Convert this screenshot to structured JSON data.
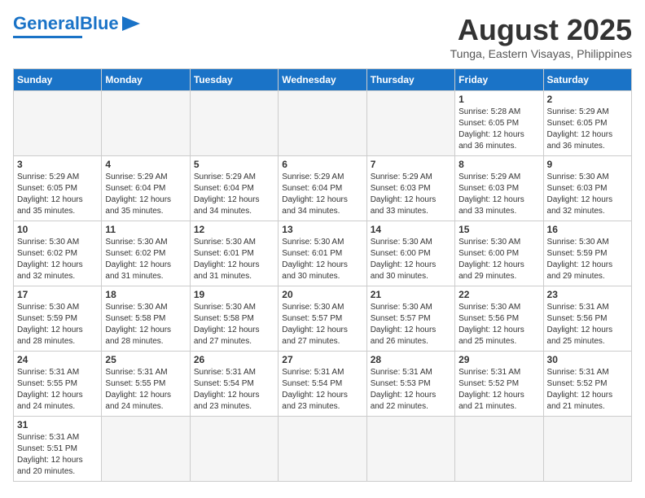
{
  "header": {
    "logo_general": "General",
    "logo_blue": "Blue",
    "month_title": "August 2025",
    "subtitle": "Tunga, Eastern Visayas, Philippines"
  },
  "weekdays": [
    "Sunday",
    "Monday",
    "Tuesday",
    "Wednesday",
    "Thursday",
    "Friday",
    "Saturday"
  ],
  "weeks": [
    [
      {
        "day": "",
        "info": ""
      },
      {
        "day": "",
        "info": ""
      },
      {
        "day": "",
        "info": ""
      },
      {
        "day": "",
        "info": ""
      },
      {
        "day": "",
        "info": ""
      },
      {
        "day": "1",
        "info": "Sunrise: 5:28 AM\nSunset: 6:05 PM\nDaylight: 12 hours and 36 minutes."
      },
      {
        "day": "2",
        "info": "Sunrise: 5:29 AM\nSunset: 6:05 PM\nDaylight: 12 hours and 36 minutes."
      }
    ],
    [
      {
        "day": "3",
        "info": "Sunrise: 5:29 AM\nSunset: 6:05 PM\nDaylight: 12 hours and 35 minutes."
      },
      {
        "day": "4",
        "info": "Sunrise: 5:29 AM\nSunset: 6:04 PM\nDaylight: 12 hours and 35 minutes."
      },
      {
        "day": "5",
        "info": "Sunrise: 5:29 AM\nSunset: 6:04 PM\nDaylight: 12 hours and 34 minutes."
      },
      {
        "day": "6",
        "info": "Sunrise: 5:29 AM\nSunset: 6:04 PM\nDaylight: 12 hours and 34 minutes."
      },
      {
        "day": "7",
        "info": "Sunrise: 5:29 AM\nSunset: 6:03 PM\nDaylight: 12 hours and 33 minutes."
      },
      {
        "day": "8",
        "info": "Sunrise: 5:29 AM\nSunset: 6:03 PM\nDaylight: 12 hours and 33 minutes."
      },
      {
        "day": "9",
        "info": "Sunrise: 5:30 AM\nSunset: 6:03 PM\nDaylight: 12 hours and 32 minutes."
      }
    ],
    [
      {
        "day": "10",
        "info": "Sunrise: 5:30 AM\nSunset: 6:02 PM\nDaylight: 12 hours and 32 minutes."
      },
      {
        "day": "11",
        "info": "Sunrise: 5:30 AM\nSunset: 6:02 PM\nDaylight: 12 hours and 31 minutes."
      },
      {
        "day": "12",
        "info": "Sunrise: 5:30 AM\nSunset: 6:01 PM\nDaylight: 12 hours and 31 minutes."
      },
      {
        "day": "13",
        "info": "Sunrise: 5:30 AM\nSunset: 6:01 PM\nDaylight: 12 hours and 30 minutes."
      },
      {
        "day": "14",
        "info": "Sunrise: 5:30 AM\nSunset: 6:00 PM\nDaylight: 12 hours and 30 minutes."
      },
      {
        "day": "15",
        "info": "Sunrise: 5:30 AM\nSunset: 6:00 PM\nDaylight: 12 hours and 29 minutes."
      },
      {
        "day": "16",
        "info": "Sunrise: 5:30 AM\nSunset: 5:59 PM\nDaylight: 12 hours and 29 minutes."
      }
    ],
    [
      {
        "day": "17",
        "info": "Sunrise: 5:30 AM\nSunset: 5:59 PM\nDaylight: 12 hours and 28 minutes."
      },
      {
        "day": "18",
        "info": "Sunrise: 5:30 AM\nSunset: 5:58 PM\nDaylight: 12 hours and 28 minutes."
      },
      {
        "day": "19",
        "info": "Sunrise: 5:30 AM\nSunset: 5:58 PM\nDaylight: 12 hours and 27 minutes."
      },
      {
        "day": "20",
        "info": "Sunrise: 5:30 AM\nSunset: 5:57 PM\nDaylight: 12 hours and 27 minutes."
      },
      {
        "day": "21",
        "info": "Sunrise: 5:30 AM\nSunset: 5:57 PM\nDaylight: 12 hours and 26 minutes."
      },
      {
        "day": "22",
        "info": "Sunrise: 5:30 AM\nSunset: 5:56 PM\nDaylight: 12 hours and 25 minutes."
      },
      {
        "day": "23",
        "info": "Sunrise: 5:31 AM\nSunset: 5:56 PM\nDaylight: 12 hours and 25 minutes."
      }
    ],
    [
      {
        "day": "24",
        "info": "Sunrise: 5:31 AM\nSunset: 5:55 PM\nDaylight: 12 hours and 24 minutes."
      },
      {
        "day": "25",
        "info": "Sunrise: 5:31 AM\nSunset: 5:55 PM\nDaylight: 12 hours and 24 minutes."
      },
      {
        "day": "26",
        "info": "Sunrise: 5:31 AM\nSunset: 5:54 PM\nDaylight: 12 hours and 23 minutes."
      },
      {
        "day": "27",
        "info": "Sunrise: 5:31 AM\nSunset: 5:54 PM\nDaylight: 12 hours and 23 minutes."
      },
      {
        "day": "28",
        "info": "Sunrise: 5:31 AM\nSunset: 5:53 PM\nDaylight: 12 hours and 22 minutes."
      },
      {
        "day": "29",
        "info": "Sunrise: 5:31 AM\nSunset: 5:52 PM\nDaylight: 12 hours and 21 minutes."
      },
      {
        "day": "30",
        "info": "Sunrise: 5:31 AM\nSunset: 5:52 PM\nDaylight: 12 hours and 21 minutes."
      }
    ],
    [
      {
        "day": "31",
        "info": "Sunrise: 5:31 AM\nSunset: 5:51 PM\nDaylight: 12 hours and 20 minutes."
      },
      {
        "day": "",
        "info": ""
      },
      {
        "day": "",
        "info": ""
      },
      {
        "day": "",
        "info": ""
      },
      {
        "day": "",
        "info": ""
      },
      {
        "day": "",
        "info": ""
      },
      {
        "day": "",
        "info": ""
      }
    ]
  ]
}
